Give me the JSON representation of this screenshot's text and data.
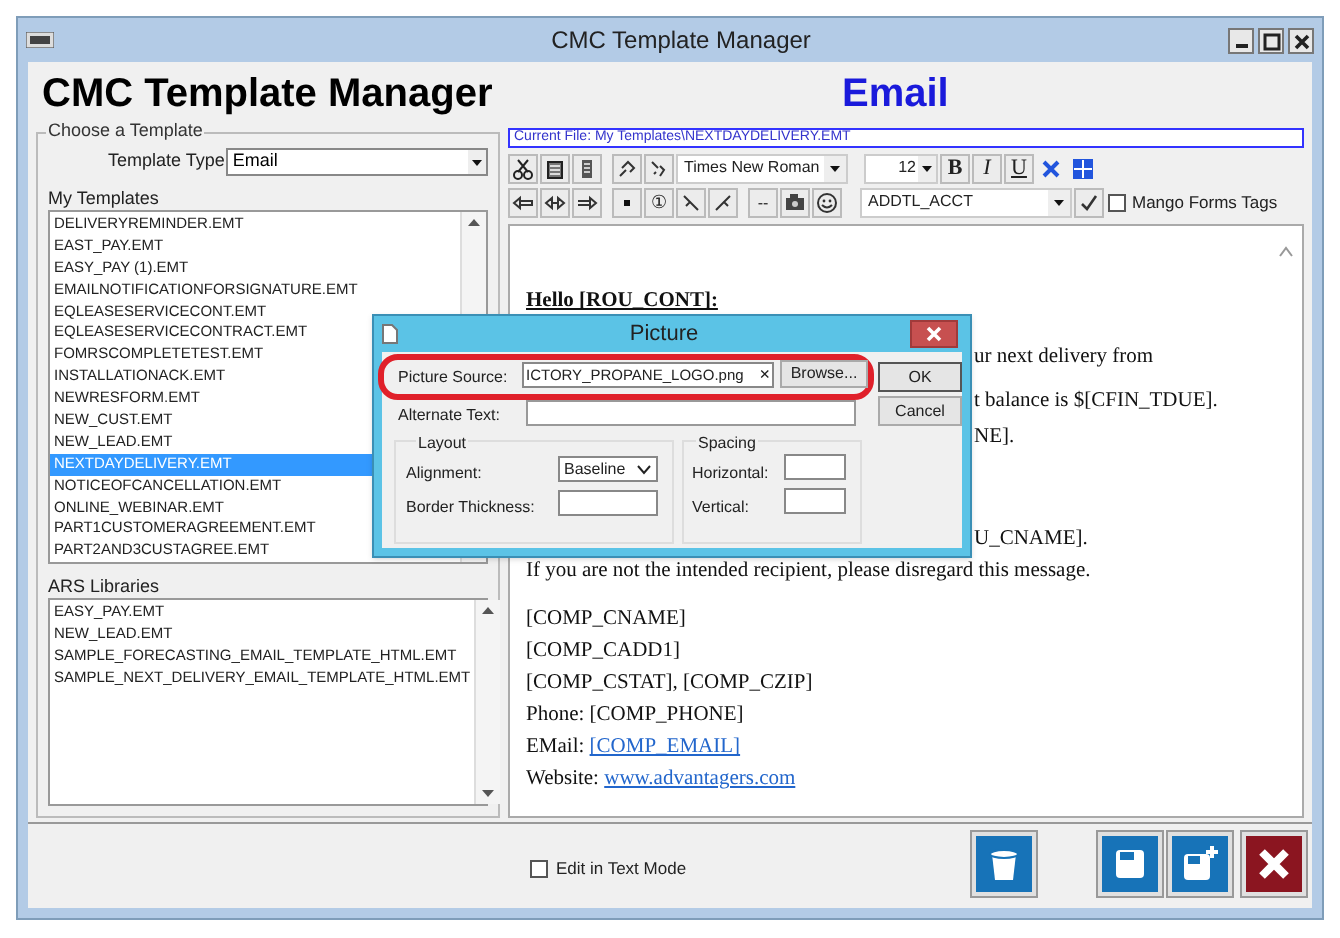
{
  "window": {
    "title": "CMC Template Manager"
  },
  "header": {
    "title": "CMC Template Manager",
    "type_label": "Email"
  },
  "chooser": {
    "group_label": "Choose a Template",
    "type_label": "Template Type",
    "type_value": "Email",
    "my_templates": {
      "label": "My Templates",
      "items": [
        {
          "name": "DELIVERYREMINDER.EMT",
          "selected": false
        },
        {
          "name": "EAST_PAY.EMT",
          "selected": false
        },
        {
          "name": "EASY_PAY (1).EMT",
          "selected": false
        },
        {
          "name": "EMAILNOTIFICATIONFORSIGNATURE.EMT",
          "selected": false
        },
        {
          "name": "EQLEASESERVICECONT.EMT",
          "selected": false
        },
        {
          "name": "EQLEASESERVICECONTRACT.EMT",
          "selected": false
        },
        {
          "name": "FOMRSCOMPLETETEST.EMT",
          "selected": false
        },
        {
          "name": "INSTALLATIONACK.EMT",
          "selected": false
        },
        {
          "name": "NEWRESFORM.EMT",
          "selected": false
        },
        {
          "name": "NEW_CUST.EMT",
          "selected": false
        },
        {
          "name": "NEW_LEAD.EMT",
          "selected": false
        },
        {
          "name": "NEXTDAYDELIVERY.EMT",
          "selected": true
        },
        {
          "name": "NOTICEOFCANCELLATION.EMT",
          "selected": false
        },
        {
          "name": "ONLINE_WEBINAR.EMT",
          "selected": false
        },
        {
          "name": "PART1CUSTOMERAGREEMENT.EMT",
          "selected": false
        },
        {
          "name": "PART2AND3CUSTAGREE.EMT",
          "selected": false
        }
      ]
    },
    "ars_libraries": {
      "label": "ARS Libraries",
      "items": [
        {
          "name": "EASY_PAY.EMT",
          "selected": false
        },
        {
          "name": "NEW_LEAD.EMT",
          "selected": false
        },
        {
          "name": "SAMPLE_FORECASTING_EMAIL_TEMPLATE_HTML.EMT",
          "selected": false
        },
        {
          "name": "SAMPLE_NEXT_DELIVERY_EMAIL_TEMPLATE_HTML.EMT",
          "selected": false
        }
      ]
    }
  },
  "editor": {
    "current_file": "Current File: My Templates\\NEXTDAYDELIVERY.EMT",
    "toolbar": {
      "font": "Times New Roman",
      "size": "12",
      "format_buttons": [
        "B",
        "I",
        "U"
      ],
      "numbering_button": "①",
      "rule_button": "--",
      "field": "ADDTL_ACCT",
      "mango_tags": {
        "label": "Mango Forms Tags",
        "checked": false
      }
    },
    "lines": [
      {
        "kind": "heading",
        "parts": [
          {
            "kind": "text",
            "text": "Hello [ROU_CONT]:"
          }
        ]
      },
      {
        "kind": "partial",
        "parts": [
          {
            "kind": "text",
            "text": "ur next delivery from"
          }
        ]
      },
      {
        "kind": "partial",
        "parts": [
          {
            "kind": "text",
            "text": "t balance is $[CFIN_TDUE]."
          }
        ]
      },
      {
        "kind": "partial",
        "parts": [
          {
            "kind": "text",
            "text": "NE]."
          }
        ]
      },
      {
        "kind": "partial",
        "parts": [
          {
            "kind": "text",
            "text": "U_CNAME]."
          }
        ]
      },
      {
        "kind": "body",
        "parts": [
          {
            "kind": "text",
            "text": "If you are not the intended recipient, please disregard this message."
          }
        ]
      },
      {
        "kind": "body",
        "parts": [
          {
            "kind": "text",
            "text": "[COMP_CNAME]"
          }
        ]
      },
      {
        "kind": "body",
        "parts": [
          {
            "kind": "text",
            "text": "[COMP_CADD1]"
          }
        ]
      },
      {
        "kind": "body",
        "parts": [
          {
            "kind": "text",
            "text": "[COMP_CSTAT], [COMP_CZIP]"
          }
        ]
      },
      {
        "kind": "body",
        "parts": [
          {
            "kind": "text",
            "text": "Phone: [COMP_PHONE]"
          }
        ]
      },
      {
        "kind": "body",
        "parts": [
          {
            "kind": "text",
            "text": "EMail: "
          },
          {
            "kind": "link",
            "text": "[COMP_EMAIL]"
          }
        ]
      },
      {
        "kind": "body",
        "parts": [
          {
            "kind": "text",
            "text": "Website: "
          },
          {
            "kind": "link",
            "text": "www.advantagers.com"
          }
        ]
      }
    ]
  },
  "edit_in_text_mode": {
    "label": "Edit in Text Mode",
    "checked": false
  },
  "dialog": {
    "title": "Picture",
    "picture_source_label": "Picture Source:",
    "picture_source_value": "ICTORY_PROPANE_LOGO.png",
    "clear_button": "×",
    "browse_button": "Browse...",
    "ok_button": "OK",
    "cancel_button": "Cancel",
    "alternate_text_label": "Alternate Text:",
    "layout_label": "Layout",
    "alignment_label": "Alignment:",
    "alignment_value": "Baseline",
    "border_label": "Border Thickness:",
    "spacing_label": "Spacing",
    "horizontal_label": "Horizontal:",
    "vertical_label": "Vertical:",
    "highlighted": true
  }
}
